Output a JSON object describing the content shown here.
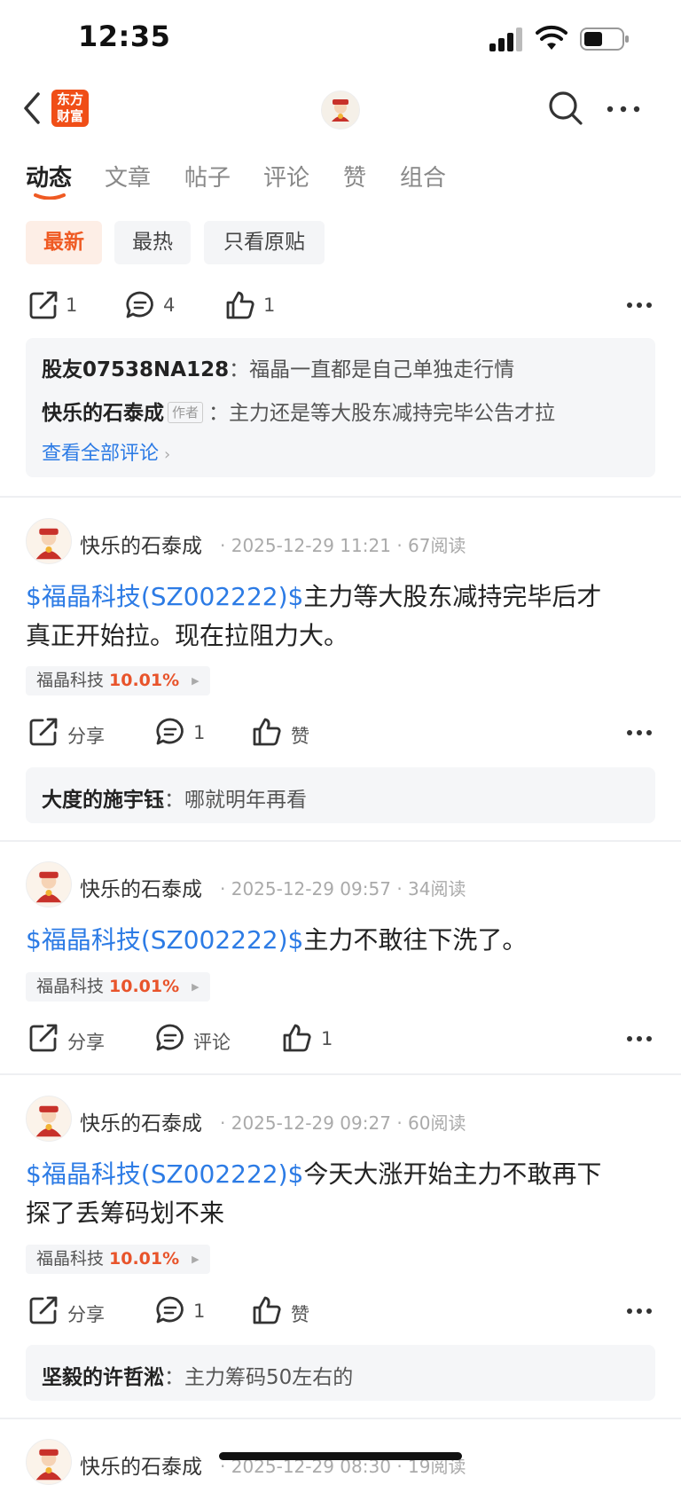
{
  "status_bar": {
    "time": "12:35"
  },
  "header": {
    "logo_text": "东方财富"
  },
  "tabs": [
    "动态",
    "文章",
    "帖子",
    "评论",
    "赞",
    "组合"
  ],
  "filters": [
    "最新",
    "最热",
    "只看原贴"
  ],
  "post0": {
    "actions": {
      "share": "1",
      "comment": "4",
      "like": "1"
    },
    "comments": [
      {
        "user": "股友07538NA128",
        "sep": "：",
        "text": "福晶一直都是自己单独走行情"
      },
      {
        "user": "快乐的石泰成",
        "tag": "作者",
        "sep": "：",
        "text": "主力还是等大股东减持完毕公告才拉"
      }
    ],
    "view_all": "查看全部评论"
  },
  "posts": [
    {
      "author": "快乐的石泰成",
      "date": "2025-12-29 11:21",
      "reads": "67阅读",
      "stock": "$福晶科技(SZ002222)$",
      "text1": "主力等大股东减持完毕后才",
      "text2": "真正开始拉。现在拉阻力大。",
      "tag_name": "福晶科技",
      "tag_pct": "10.01%",
      "share": "分享",
      "comment": "1",
      "like": "赞",
      "reply": {
        "user": "大度的施宇钰",
        "sep": "：",
        "text": "哪就明年再看"
      }
    },
    {
      "author": "快乐的石泰成",
      "date": "2025-12-29 09:57",
      "reads": "34阅读",
      "stock": "$福晶科技(SZ002222)$",
      "text1": "主力不敢往下洗了。",
      "tag_name": "福晶科技",
      "tag_pct": "10.01%",
      "share": "分享",
      "comment": "评论",
      "like": "1"
    },
    {
      "author": "快乐的石泰成",
      "date": "2025-12-29 09:27",
      "reads": "60阅读",
      "stock": "$福晶科技(SZ002222)$",
      "text1": "今天大涨开始主力不敢再下",
      "text2": "探了丢筹码划不来",
      "tag_name": "福晶科技",
      "tag_pct": "10.01%",
      "share": "分享",
      "comment": "1",
      "like": "赞",
      "reply": {
        "user": "坚毅的许哲淞",
        "sep": "：",
        "text": "主力筹码50左右的"
      }
    },
    {
      "author": "快乐的石泰成",
      "date": "2025-12-29 08:30",
      "reads": "19阅读"
    }
  ],
  "dot": "·",
  "colors": {
    "accent": "#ef5a23",
    "link": "#2c7be5",
    "up": "#e8542b"
  }
}
